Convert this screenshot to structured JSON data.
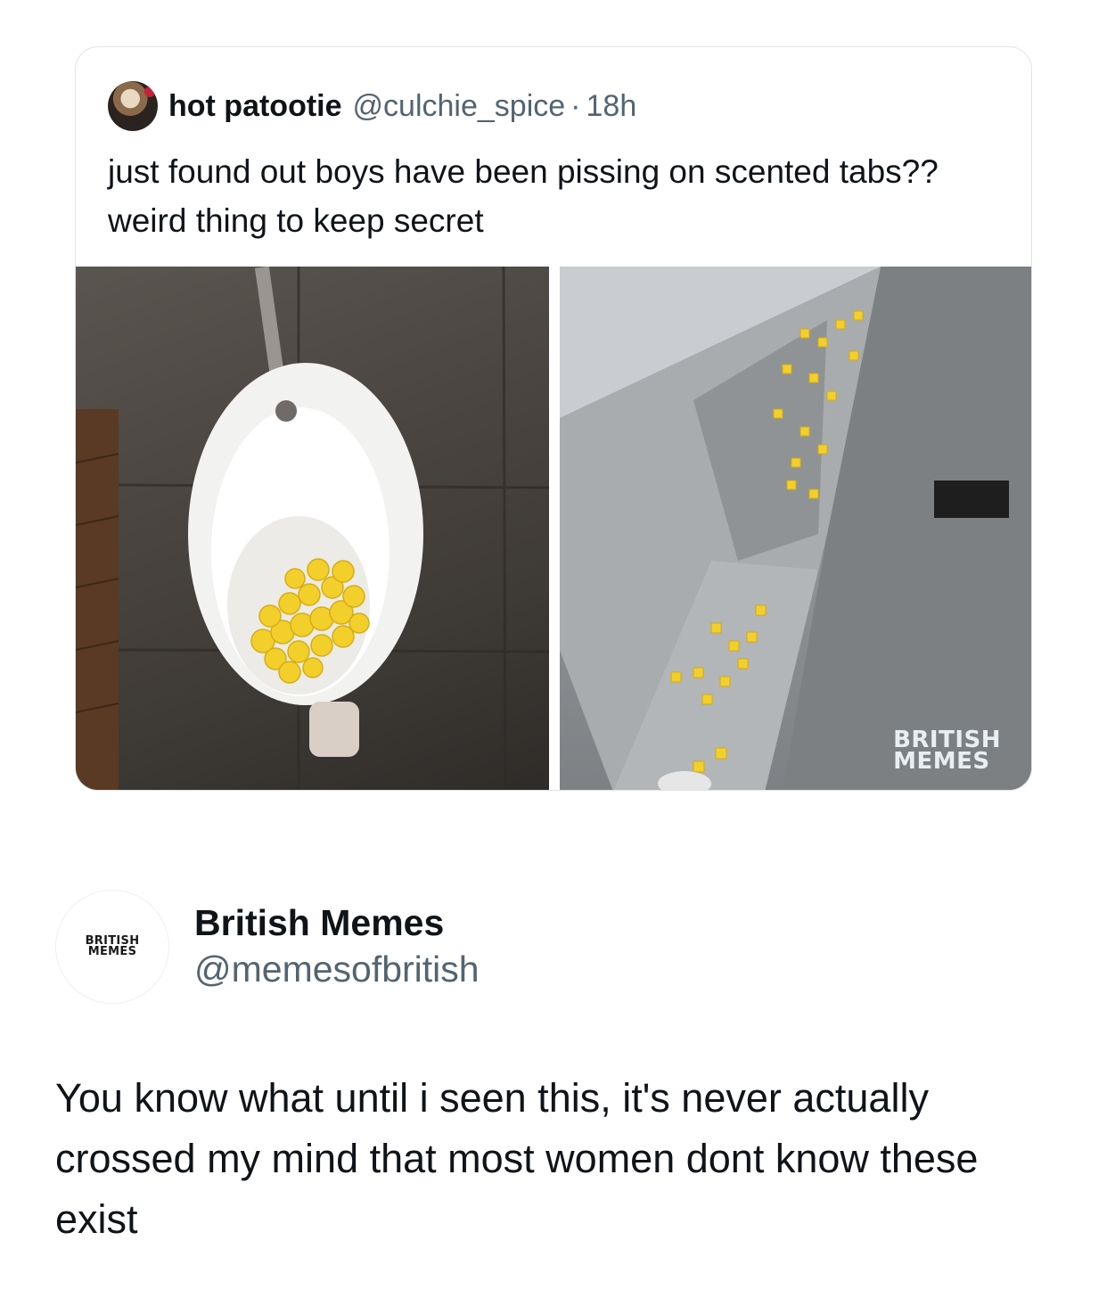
{
  "quote": {
    "display_name": "hot patootie",
    "handle": "@culchie_spice",
    "separator": "·",
    "time": "18h",
    "text": "just found out boys have been pissing on scented tabs?? weird thing to keep secret",
    "watermark_line1": "BRITISH",
    "watermark_line2": "MEMES"
  },
  "reply": {
    "avatar_line1": "BRITISH",
    "avatar_line2": "MEMES",
    "display_name": "British Memes",
    "handle": "@memesofbritish",
    "text": "You know what until i seen this, it's never actually crossed my mind that most women dont know these exist"
  },
  "colors": {
    "text_primary": "#0f1419",
    "text_secondary": "#536471",
    "card_border": "#dfe3e6",
    "tab_yellow": "#f3cf2c"
  }
}
